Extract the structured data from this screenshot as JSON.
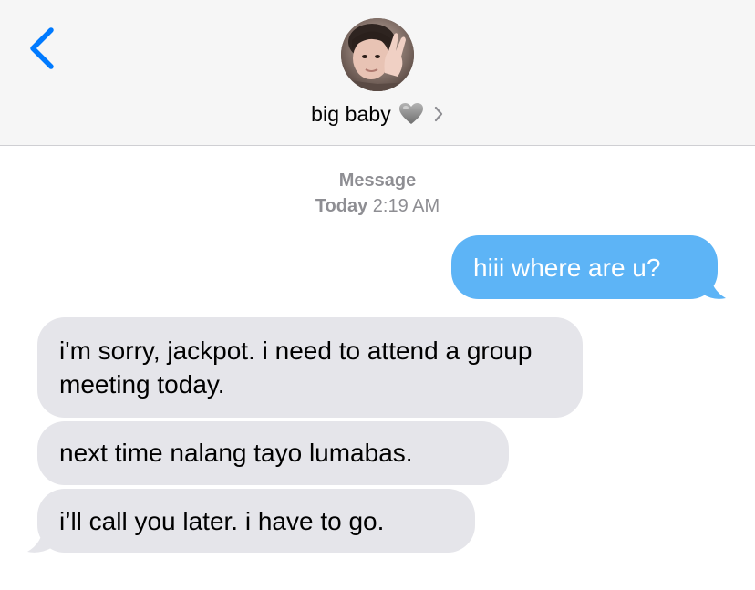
{
  "header": {
    "back_icon": "chevron-left-icon",
    "contact_name": "big baby",
    "contact_emoji": "grey-heart",
    "chevron_icon": "chevron-right-icon",
    "accent_color": "#007aff"
  },
  "conversation": {
    "service_label": "Message",
    "timestamp_day": "Today",
    "timestamp_time": "2:19 AM",
    "messages": [
      {
        "direction": "sent",
        "text": "hiii where are u?"
      },
      {
        "direction": "received",
        "text": "i'm sorry, jackpot. i need to attend a group meeting today."
      },
      {
        "direction": "received",
        "text": "next time nalang tayo lumabas."
      },
      {
        "direction": "received",
        "text": "i’ll call you later. i have to go."
      }
    ]
  },
  "colors": {
    "sent_bubble": "#5db4f6",
    "received_bubble": "#e5e5ea",
    "header_bg": "#f6f6f6",
    "meta_text": "#8e8e93"
  }
}
